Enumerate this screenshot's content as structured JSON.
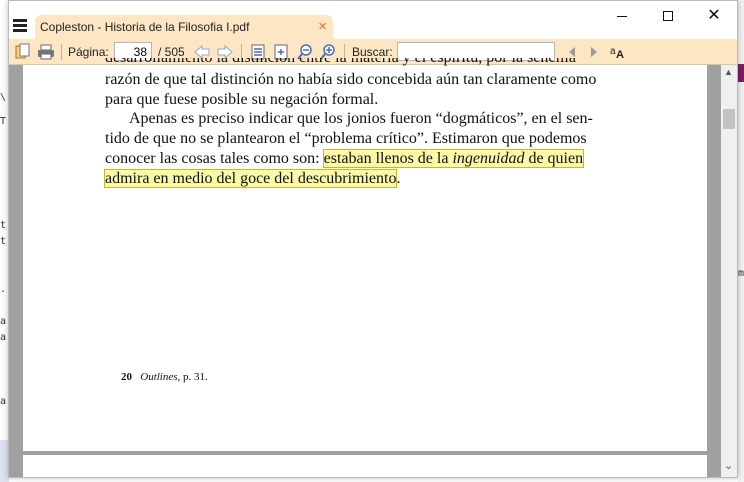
{
  "background": {
    "left_chars": [
      "\\",
      "T",
      "t",
      "t",
      ".",
      "a",
      "a",
      "a"
    ],
    "right_char": "m"
  },
  "window": {
    "tab_title": "Copleston - Historia de la Filosofia I.pdf",
    "tab_close": "×",
    "minimize": "minimize",
    "maximize": "maximize",
    "close": "✕"
  },
  "toolbar": {
    "page_label": "Página:",
    "page_value": "38",
    "page_total": "/ 505",
    "search_label": "Buscar:",
    "search_value": ""
  },
  "document": {
    "lines": [
      "razón de que tal distinción no había sido concebida aún tan claramente como",
      "para que fuese posible su negación formal."
    ],
    "para2_line1": "Apenas es preciso indicar que los jonios fueron “dogmáticos”, en el sen-",
    "para2_line2": "tido de que no se plantearon el “problema crítico”. Estimaron que podemos",
    "para2_line3_plain": "conocer las cosas tales como son: ",
    "para2_line3_hl_a": "estaban llenos de la ",
    "para2_line3_hl_italic": "ingenuidad",
    "para2_line3_hl_b": " de quien",
    "para2_line4_hl": "admira en medio del goce del descubrimiento",
    "para2_line4_end": ".",
    "footnote_num": "20",
    "footnote_work": "Outlines,",
    "footnote_page": "p. 31."
  },
  "colors": {
    "accent": "#fce6c4",
    "highlight": "#fbf8a8",
    "tab_close": "#e07010"
  }
}
